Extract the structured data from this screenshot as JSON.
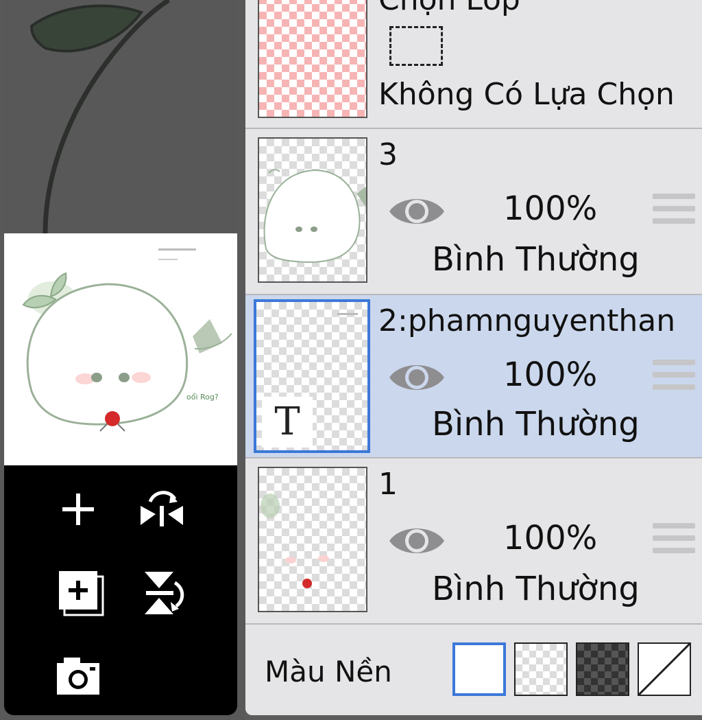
{
  "layers_panel": {
    "selection_layer": {
      "title_partial": "Chọn Lớp",
      "status": "Không Có Lựa Chọn"
    },
    "layers": [
      {
        "name": "3",
        "opacity": "100%",
        "blend_mode": "Bình Thường",
        "selected": false
      },
      {
        "name": "2:phamnguyenthan",
        "opacity": "100%",
        "blend_mode": "Bình Thường",
        "selected": true,
        "type_badge": "T"
      },
      {
        "name": "1",
        "opacity": "100%",
        "blend_mode": "Bình Thường",
        "selected": false
      }
    ],
    "background": {
      "label": "Màu Nền",
      "options": [
        "white",
        "checker-light",
        "checker-dark",
        "none"
      ],
      "selected_index": 0
    }
  },
  "preview": {
    "caption_text": "oổi Rog?"
  },
  "colors": {
    "accent": "#3c78d8",
    "selected_row": "#cbd7ec",
    "panel_bg": "#e5e5e7"
  },
  "icons": [
    "add-layer-icon",
    "flip-horizontal-icon",
    "duplicate-layer-icon",
    "flip-vertical-icon",
    "camera-icon",
    "eye-icon",
    "drag-handle-icon"
  ]
}
